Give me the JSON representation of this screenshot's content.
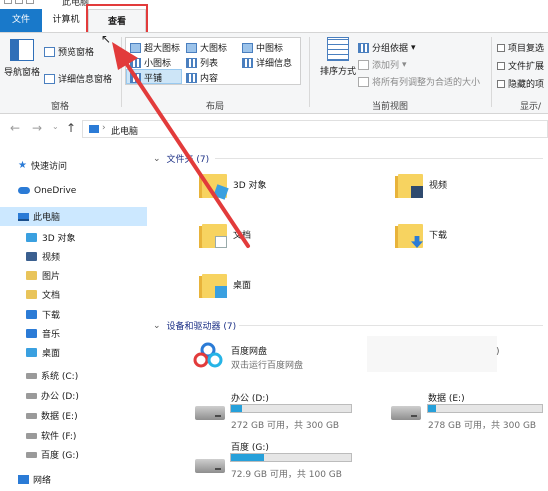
{
  "window": {
    "title": "此电脑"
  },
  "tabs": {
    "file": "文件",
    "computer": "计算机",
    "view": "查看"
  },
  "ribbon": {
    "pane": {
      "nav_pane": "导航窗格",
      "preview_pane": "预览窗格",
      "details_pane": "详细信息窗格",
      "group_label": "窗格"
    },
    "layout": {
      "extra_large": "超大图标",
      "large": "大图标",
      "medium": "中图标",
      "small": "小图标",
      "list": "列表",
      "details": "详细信息",
      "tiles": "平铺",
      "content": "内容",
      "group_label": "布局"
    },
    "current_view": {
      "sort_by": "排序方式",
      "group_by": "分组依据",
      "add_columns": "添加列",
      "size_all_columns": "将所有列调整为合适的大小",
      "group_label": "当前视图"
    },
    "show_hide": {
      "item_checkboxes": "项目复选",
      "file_extensions": "文件扩展",
      "hidden_items": "隐藏的项",
      "group_label": "显示/"
    }
  },
  "address": {
    "path": "此电脑"
  },
  "sidebar": {
    "items": [
      {
        "label": "快速访问"
      },
      {
        "label": "OneDrive"
      },
      {
        "label": "此电脑"
      },
      {
        "label": "3D 对象"
      },
      {
        "label": "视频"
      },
      {
        "label": "图片"
      },
      {
        "label": "文档"
      },
      {
        "label": "下载"
      },
      {
        "label": "音乐"
      },
      {
        "label": "桌面"
      },
      {
        "label": "系统 (C:)"
      },
      {
        "label": "办公 (D:)"
      },
      {
        "label": "数据 (E:)"
      },
      {
        "label": "软件 (F:)"
      },
      {
        "label": "百度 (G:)"
      },
      {
        "label": "网络"
      }
    ]
  },
  "folders": {
    "header": "文件夹 (7)",
    "items": [
      {
        "name": "3D 对象"
      },
      {
        "name": "视频"
      },
      {
        "name": "文档"
      },
      {
        "name": "下载"
      },
      {
        "name": "桌面"
      }
    ]
  },
  "devices": {
    "header": "设备和驱动器 (7)",
    "baidu_app": {
      "name": "百度网盘",
      "subtitle": "双击运行百度网盘"
    },
    "drives": [
      {
        "name": "办公 (D:)",
        "info": "272 GB 可用，共 300 GB",
        "used_fraction": 0.093
      },
      {
        "name": "数据 (E:)",
        "info": "278 GB 可用，共 300 GB",
        "used_fraction": 0.073
      },
      {
        "name": "百度 (G:)",
        "info": "72.9 GB 可用，共 100 GB",
        "used_fraction": 0.271
      }
    ]
  },
  "colors": {
    "accent": "#1979ca",
    "selection": "#cce8ff",
    "annotation": "#e23b3b",
    "drive_bar": "#26a0da"
  }
}
